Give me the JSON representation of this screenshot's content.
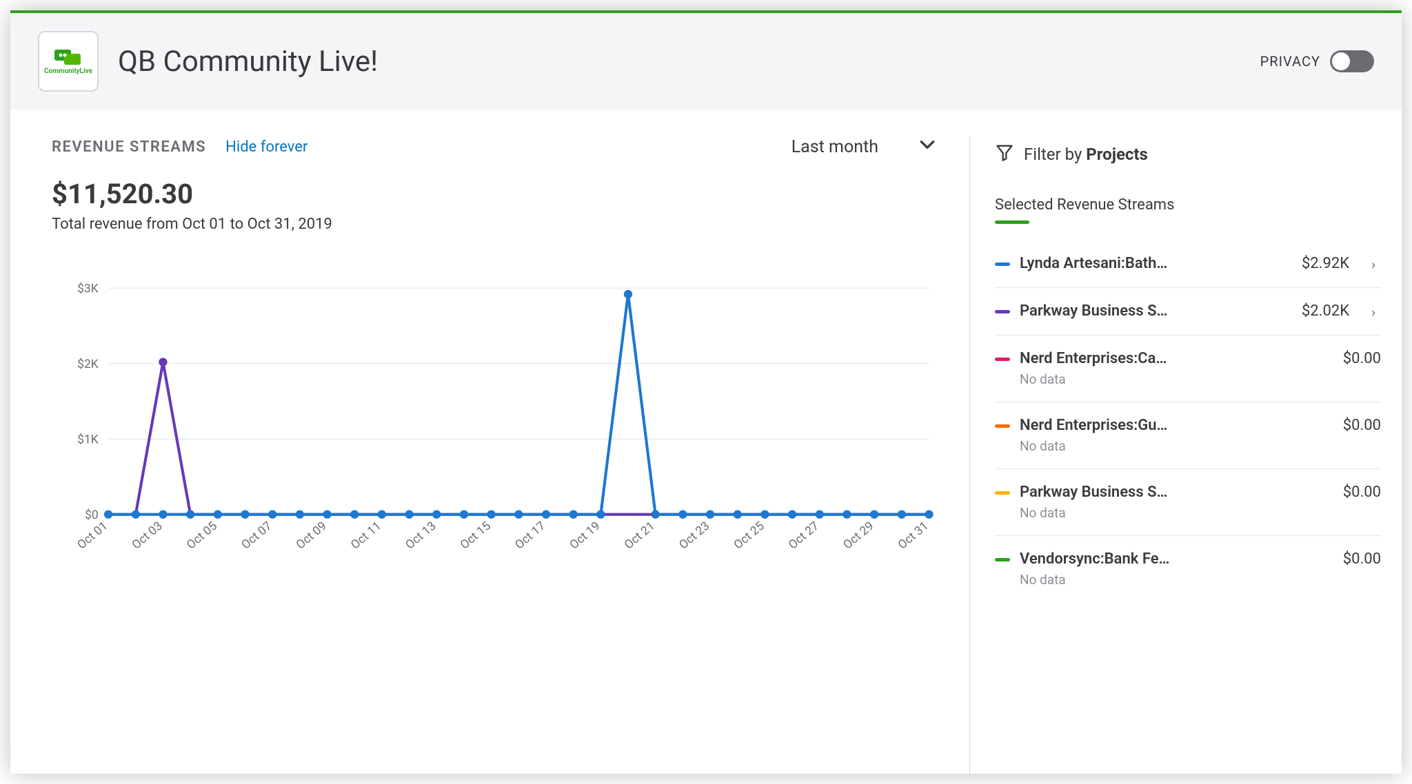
{
  "header": {
    "logo_text": "CommunityLive",
    "title": "QB Community Live!",
    "privacy_label": "PRIVACY"
  },
  "section": {
    "title": "REVENUE STREAMS",
    "hide_link": "Hide forever",
    "range_label": "Last month",
    "total_amount": "$11,520.30",
    "total_subtext": "Total revenue from Oct 01 to Oct 31, 2019"
  },
  "sidebar": {
    "filter_prefix": "Filter by ",
    "filter_bold": "Projects",
    "tab_label": "Selected Revenue Streams",
    "streams": [
      {
        "color": "#1f77d0",
        "name": "Lynda Artesani:Bath…",
        "amount": "$2.92K",
        "sub": null,
        "arrow": true
      },
      {
        "color": "#6639b7",
        "name": "Parkway Business S…",
        "amount": "$2.02K",
        "sub": null,
        "arrow": true
      },
      {
        "color": "#e31b60",
        "name": "Nerd Enterprises:Ca…",
        "amount": "$0.00",
        "sub": "No data",
        "arrow": false
      },
      {
        "color": "#ff6a00",
        "name": "Nerd Enterprises:Gu…",
        "amount": "$0.00",
        "sub": "No data",
        "arrow": false
      },
      {
        "color": "#ffb000",
        "name": "Parkway Business S…",
        "amount": "$0.00",
        "sub": "No data",
        "arrow": false
      },
      {
        "color": "#2ca01c",
        "name": "Vendorsync:Bank Fe…",
        "amount": "$0.00",
        "sub": "No data",
        "arrow": false
      }
    ]
  },
  "chart_data": {
    "type": "line",
    "categories": [
      "Oct 01",
      "Oct 02",
      "Oct 03",
      "Oct 04",
      "Oct 05",
      "Oct 06",
      "Oct 07",
      "Oct 08",
      "Oct 09",
      "Oct 10",
      "Oct 11",
      "Oct 12",
      "Oct 13",
      "Oct 14",
      "Oct 15",
      "Oct 16",
      "Oct 17",
      "Oct 18",
      "Oct 19",
      "Oct 20",
      "Oct 21",
      "Oct 22",
      "Oct 23",
      "Oct 24",
      "Oct 25",
      "Oct 26",
      "Oct 27",
      "Oct 28",
      "Oct 29",
      "Oct 30",
      "Oct 31"
    ],
    "x_tick_labels": [
      "Oct 01",
      "Oct 03",
      "Oct 05",
      "Oct 07",
      "Oct 09",
      "Oct 11",
      "Oct 13",
      "Oct 15",
      "Oct 17",
      "Oct 19",
      "Oct 21",
      "Oct 23",
      "Oct 25",
      "Oct 27",
      "Oct 29",
      "Oct 31"
    ],
    "y_ticks": [
      0,
      1000,
      2000,
      3000
    ],
    "y_tick_labels": [
      "$0",
      "$1K",
      "$2K",
      "$3K"
    ],
    "ylim": [
      0,
      3000
    ],
    "series": [
      {
        "name": "Lynda Artesani:Bath…",
        "color": "#1f77d0",
        "values": [
          0,
          0,
          0,
          0,
          0,
          0,
          0,
          0,
          0,
          0,
          0,
          0,
          0,
          0,
          0,
          0,
          0,
          0,
          0,
          2920,
          0,
          0,
          0,
          0,
          0,
          0,
          0,
          0,
          0,
          0,
          0
        ]
      },
      {
        "name": "Parkway Business S…",
        "color": "#6639b7",
        "values": [
          0,
          0,
          2020,
          0,
          0,
          0,
          0,
          0,
          0,
          0,
          0,
          0,
          0,
          0,
          0,
          0,
          0,
          0,
          0,
          0,
          0,
          0,
          0,
          0,
          0,
          0,
          0,
          0,
          0,
          0,
          0
        ]
      }
    ],
    "markers_series_index": 0,
    "xlabel": "",
    "ylabel": "",
    "title": ""
  }
}
